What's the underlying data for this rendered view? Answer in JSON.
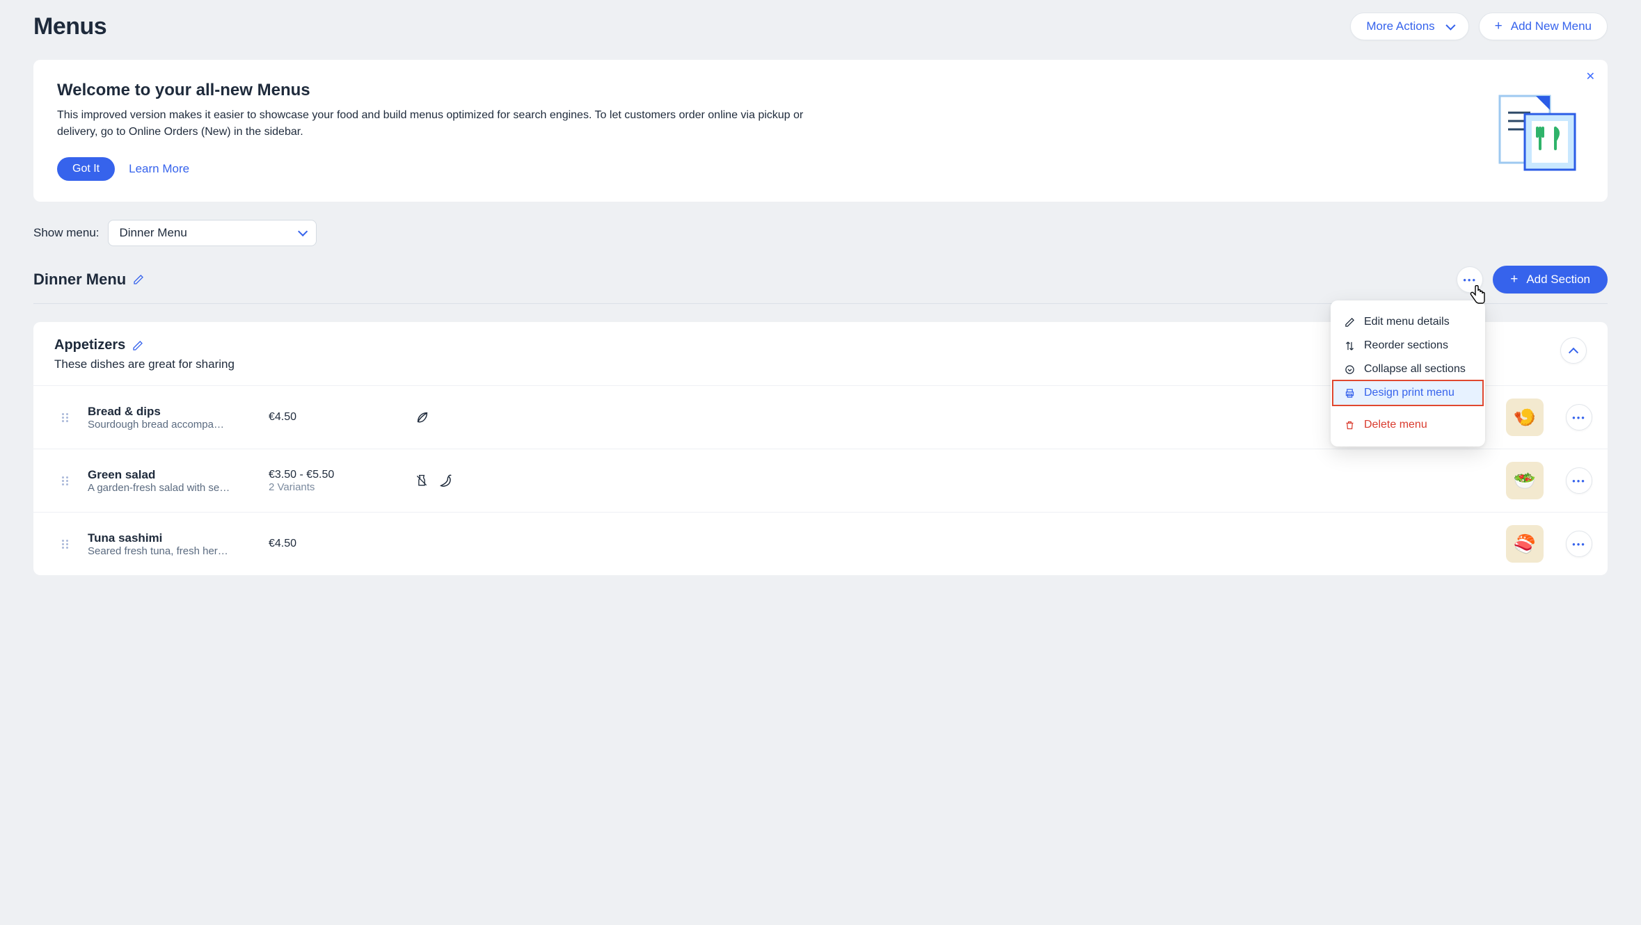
{
  "page": {
    "title": "Menus",
    "more_actions_label": "More Actions",
    "add_menu_label": "Add New Menu"
  },
  "welcome": {
    "title": "Welcome to your all-new Menus",
    "body": "This improved version makes it easier to showcase your food and build menus optimized for search engines.  To let customers order online via pickup or delivery, go to Online Orders (New) in the sidebar.",
    "got_it": "Got It",
    "learn_more": "Learn More"
  },
  "filter": {
    "label": "Show menu:",
    "selected": "Dinner Menu"
  },
  "menu": {
    "name": "Dinner Menu",
    "add_section_label": "Add Section"
  },
  "popover": {
    "edit": "Edit menu details",
    "reorder": "Reorder sections",
    "collapse": "Collapse all sections",
    "design_print": "Design print menu",
    "delete": "Delete menu"
  },
  "section": {
    "title": "Appetizers",
    "subtitle": "These dishes are great for sharing",
    "items": [
      {
        "name": "Bread & dips",
        "desc": "Sourdough bread accompa…",
        "price": "€4.50",
        "variants": "",
        "labels": [
          "leaf"
        ],
        "thumb": "🍤"
      },
      {
        "name": "Green salad",
        "desc": "A garden-fresh salad with se…",
        "price": "€3.50 - €5.50",
        "variants": "2 Variants",
        "labels": [
          "no-milk",
          "chili"
        ],
        "thumb": "🥗"
      },
      {
        "name": "Tuna sashimi",
        "desc": "Seared fresh tuna, fresh her…",
        "price": "€4.50",
        "variants": "",
        "labels": [],
        "thumb": "🍣"
      }
    ]
  }
}
